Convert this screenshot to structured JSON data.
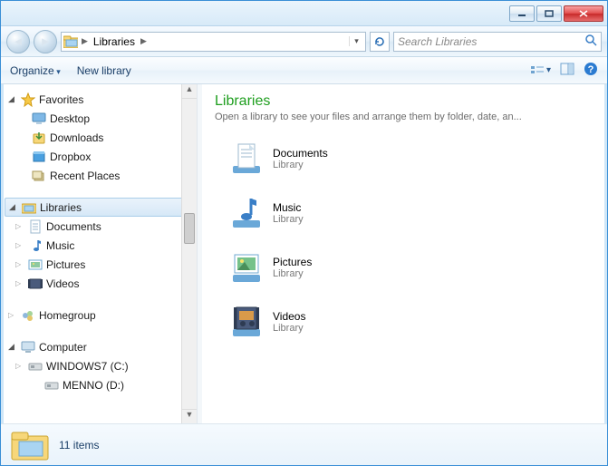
{
  "search": {
    "placeholder": "Search Libraries"
  },
  "breadcrumb": {
    "root": "Libraries"
  },
  "toolbar": {
    "organize": "Organize",
    "new_library": "New library"
  },
  "sidebar": {
    "favorites": {
      "label": "Favorites",
      "items": [
        "Desktop",
        "Downloads",
        "Dropbox",
        "Recent Places"
      ]
    },
    "libraries": {
      "label": "Libraries",
      "items": [
        "Documents",
        "Music",
        "Pictures",
        "Videos"
      ]
    },
    "homegroup": {
      "label": "Homegroup"
    },
    "computer": {
      "label": "Computer",
      "items": [
        "WINDOWS7 (C:)",
        "MENNO (D:)"
      ]
    }
  },
  "content": {
    "title": "Libraries",
    "subtitle": "Open a library to see your files and arrange them by folder, date, an...",
    "items": [
      {
        "name": "Documents",
        "type": "Library"
      },
      {
        "name": "Music",
        "type": "Library"
      },
      {
        "name": "Pictures",
        "type": "Library"
      },
      {
        "name": "Videos",
        "type": "Library"
      }
    ]
  },
  "status": {
    "count": "11 items"
  }
}
